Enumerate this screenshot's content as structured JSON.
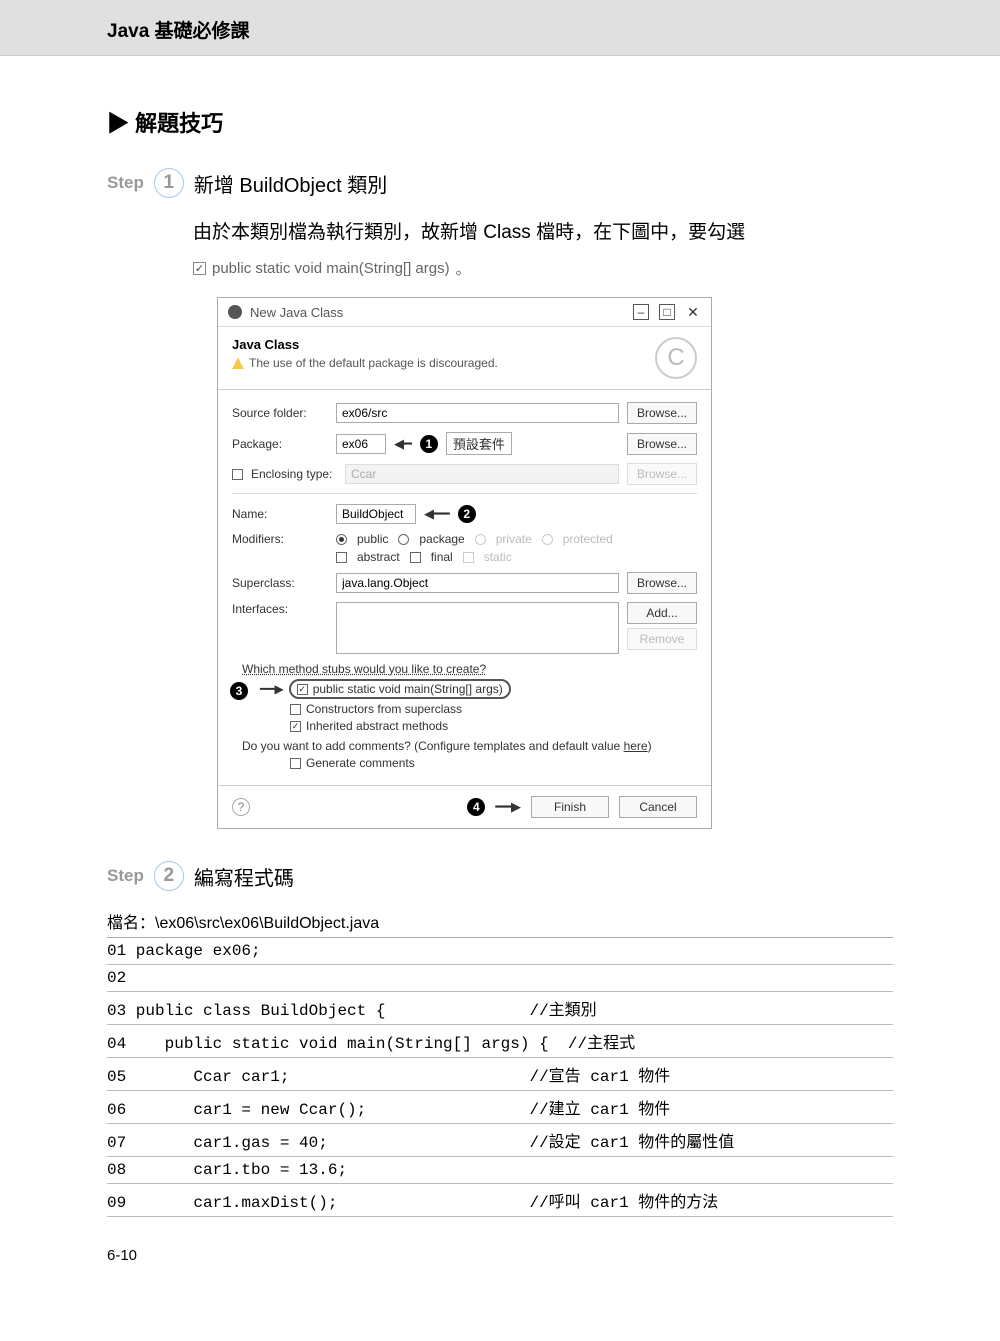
{
  "header": {
    "title": "Java 基礎必修課"
  },
  "section": {
    "title": "▶ 解題技巧"
  },
  "step1": {
    "label": "Step",
    "num": "1",
    "title": "新增 BuildObject 類別",
    "body": "由於本類別檔為執行類別，故新增 Class 檔時，在下圖中，要勾選",
    "checkbox_text": "public static void main(String[] args)",
    "period": "。"
  },
  "dialog": {
    "title": "New Java Class",
    "head_title": "Java Class",
    "warning": "The use of the default package is discouraged.",
    "logo": "C",
    "source_folder": {
      "label": "Source folder:",
      "value": "ex06/src",
      "browse": "Browse..."
    },
    "package": {
      "label": "Package:",
      "value": "ex06",
      "note": "預設套件",
      "browse": "Browse..."
    },
    "enclosing": {
      "label": "Enclosing type:",
      "value": "Ccar",
      "browse": "Browse..."
    },
    "name": {
      "label": "Name:",
      "value": "BuildObject"
    },
    "modifiers": {
      "label": "Modifiers:",
      "public": "public",
      "package": "package",
      "private": "private",
      "protected": "protected",
      "abstract": "abstract",
      "final": "final",
      "static": "static"
    },
    "superclass": {
      "label": "Superclass:",
      "value": "java.lang.Object",
      "browse": "Browse..."
    },
    "interfaces": {
      "label": "Interfaces:",
      "add": "Add...",
      "remove": "Remove"
    },
    "stubs": {
      "q": "Which method stubs would you like to create?",
      "main": "public static void main(String[] args)",
      "ctor": "Constructors from superclass",
      "inh": "Inherited abstract methods"
    },
    "comments": {
      "q": "Do you want to add comments? (Configure templates and default value ",
      "here": "here",
      "close": ")",
      "gen": "Generate comments"
    },
    "finish": "Finish",
    "cancel": "Cancel",
    "bubbles": {
      "one": "1",
      "two": "2",
      "three": "3",
      "four": "4"
    }
  },
  "step2": {
    "label": "Step",
    "num": "2",
    "title": "編寫程式碼"
  },
  "code": {
    "filename_label": "檔名：",
    "filename": "\\ex06\\src\\ex06\\BuildObject.java",
    "lines": [
      {
        "n": "01",
        "c": "package ex06;",
        "m": ""
      },
      {
        "n": "02",
        "c": "",
        "m": ""
      },
      {
        "n": "03",
        "c": "public class BuildObject {",
        "m": "//主類別"
      },
      {
        "n": "04",
        "c": "   public static void main(String[] args) {",
        "m": "//主程式"
      },
      {
        "n": "05",
        "c": "      Ccar car1;",
        "m": "//宣告 car1 物件"
      },
      {
        "n": "06",
        "c": "      car1 = new Ccar();",
        "m": "//建立 car1 物件"
      },
      {
        "n": "07",
        "c": "      car1.gas = 40;",
        "m": "//設定 car1 物件的屬性值"
      },
      {
        "n": "08",
        "c": "      car1.tbo = 13.6;",
        "m": ""
      },
      {
        "n": "09",
        "c": "      car1.maxDist();",
        "m": "//呼叫 car1 物件的方法"
      }
    ]
  },
  "page_num": "6-10"
}
